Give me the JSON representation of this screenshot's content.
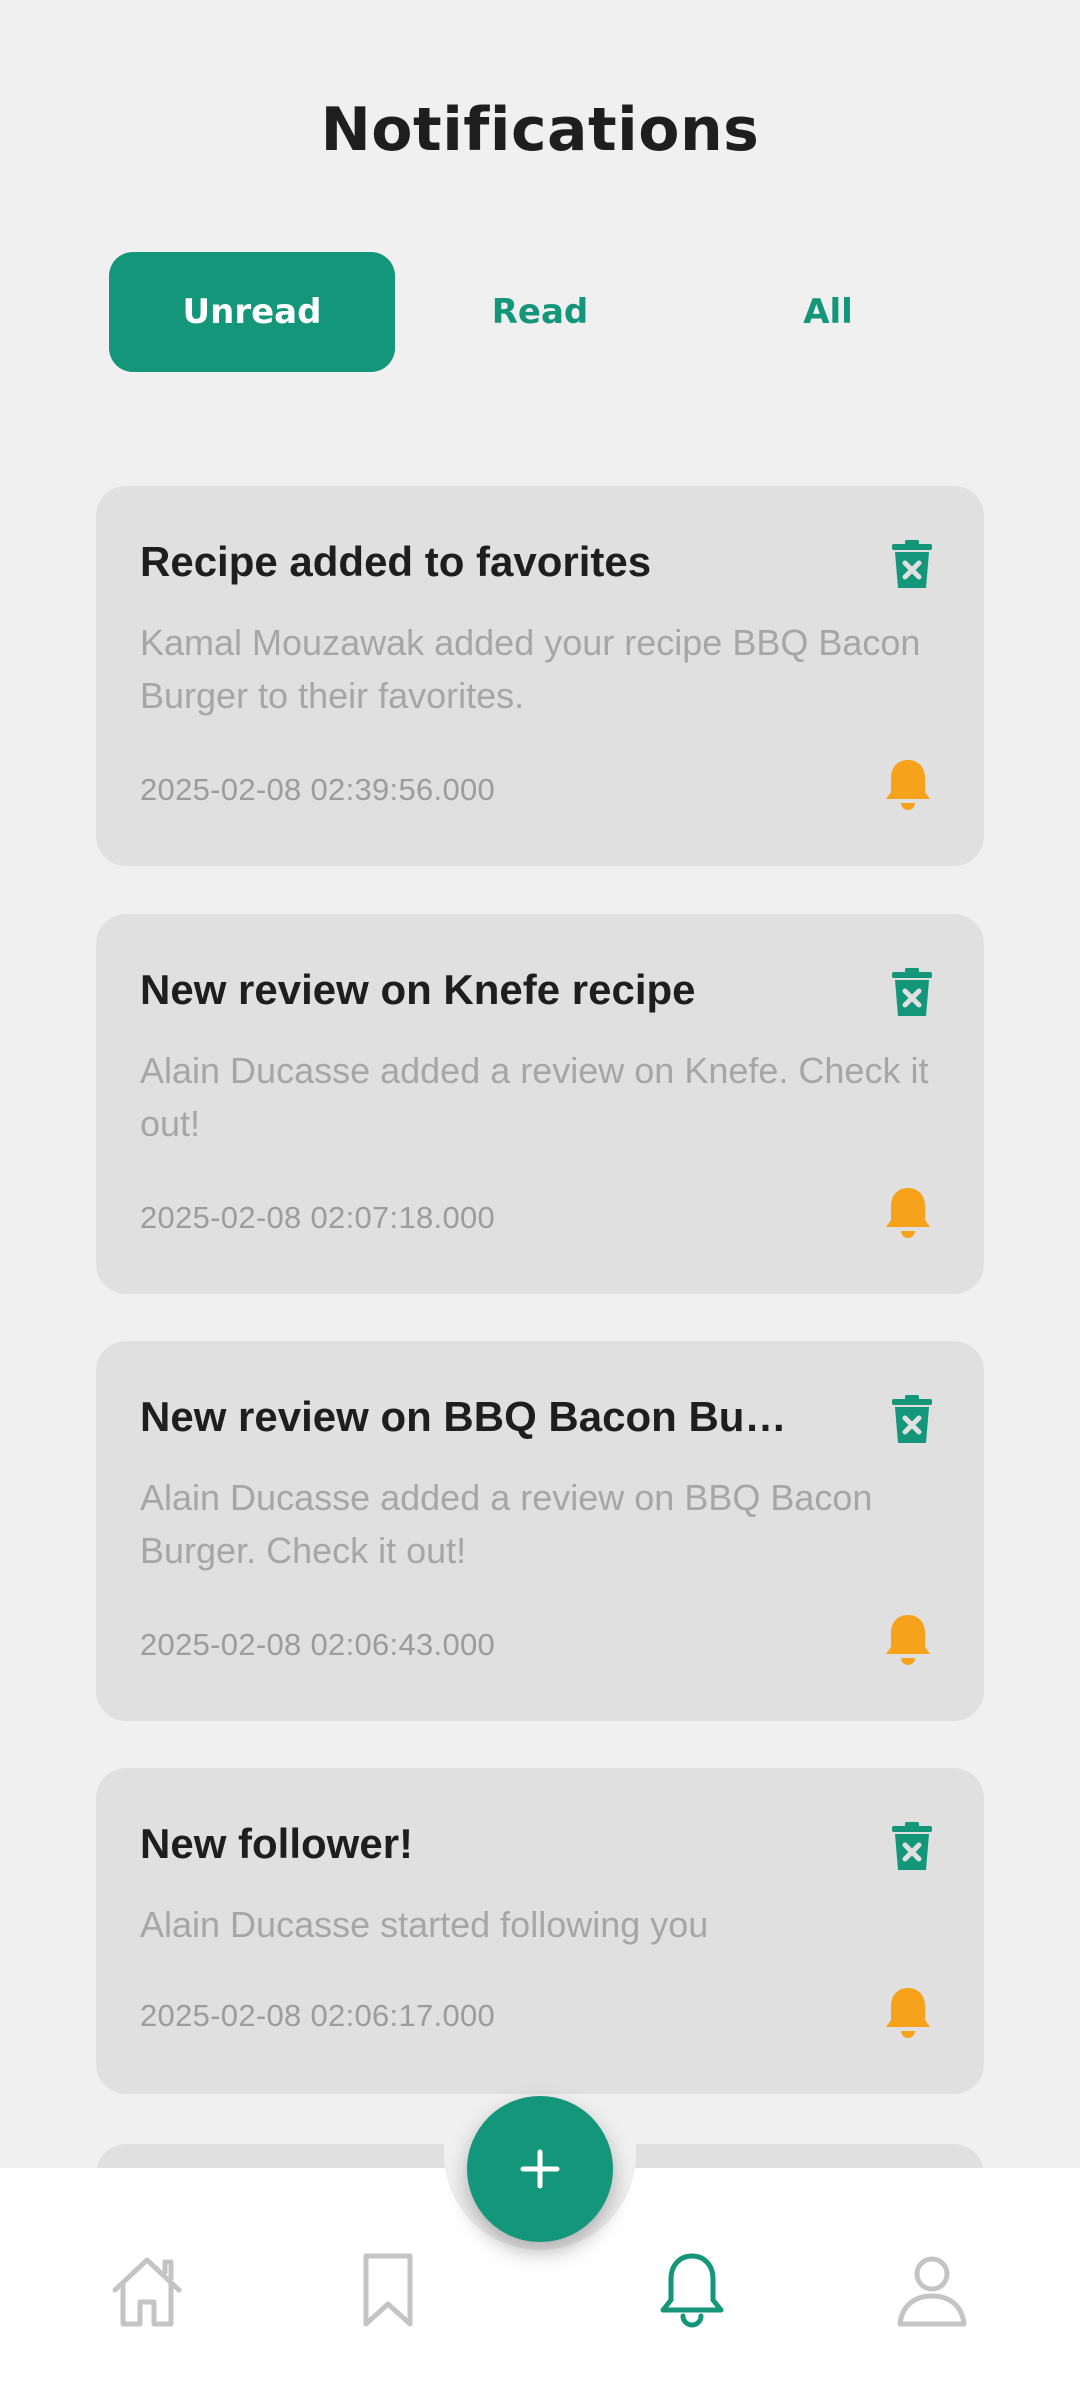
{
  "header": {
    "title": "Notifications"
  },
  "tabs": [
    {
      "label": "Unread",
      "active": true
    },
    {
      "label": "Read",
      "active": false
    },
    {
      "label": "All",
      "active": false
    }
  ],
  "notifications": [
    {
      "title": "Recipe added to favorites",
      "body": "Kamal Mouzawak added your recipe BBQ Bacon Burger to their favorites.",
      "timestamp": "2025-02-08 02:39:56.000"
    },
    {
      "title": "New review on Knefe recipe",
      "body": "Alain Ducasse added a review on Knefe. Check it out!",
      "timestamp": "2025-02-08 02:07:18.000"
    },
    {
      "title": "New review on BBQ Bacon Burger",
      "body": "Alain Ducasse added a review on BBQ Bacon Burger. Check it out!",
      "timestamp": "2025-02-08 02:06:43.000"
    },
    {
      "title": "New follower!",
      "body": "Alain Ducasse started following you",
      "timestamp": "2025-02-08 02:06:17.000"
    }
  ],
  "bottom_nav": {
    "items": [
      {
        "icon": "home-icon",
        "active": false
      },
      {
        "icon": "bookmark-icon",
        "active": false
      },
      {
        "icon": "bell-icon",
        "active": true
      },
      {
        "icon": "profile-icon",
        "active": false
      }
    ],
    "fab_icon": "plus-icon"
  },
  "colors": {
    "accent": "#13967a",
    "bell": "#f7a21b",
    "card_bg": "#e0e0e0",
    "page_bg": "#f0f0f0",
    "inactive_icon": "#c4c4c4"
  }
}
